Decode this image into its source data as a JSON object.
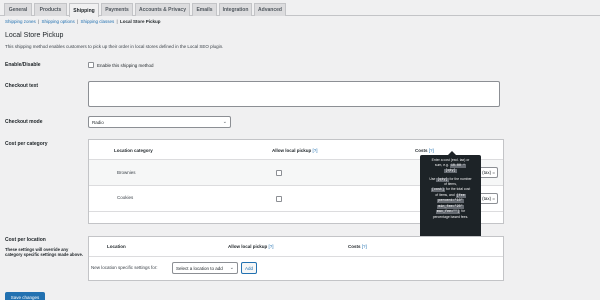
{
  "tabs": [
    {
      "label": "General",
      "active": false
    },
    {
      "label": "Products",
      "active": false
    },
    {
      "label": "Shipping",
      "active": true
    },
    {
      "label": "Payments",
      "active": false
    },
    {
      "label": "Accounts & Privacy",
      "active": false
    },
    {
      "label": "Emails",
      "active": false
    },
    {
      "label": "Integration",
      "active": false
    },
    {
      "label": "Advanced",
      "active": false
    }
  ],
  "subnav": {
    "items": [
      "Shipping zones",
      "Shipping options",
      "Shipping classes"
    ],
    "separator": "|",
    "current": "Local Store Pickup"
  },
  "page": {
    "title": "Local Store Pickup",
    "description": "This shipping method enables customers to pick up their order in local stores defined in the Local SEO plugin."
  },
  "enable": {
    "label": "Enable/Disable",
    "checkbox_label": "Enable this shipping method",
    "checked": false
  },
  "checkout_text": {
    "label": "Checkout text",
    "value": ""
  },
  "checkout_mode": {
    "label": "Checkout mode",
    "selected": "Radio"
  },
  "cost_per_category": {
    "label": "Cost per category",
    "headers": {
      "category": "Location category",
      "allow": "Allow local pickup",
      "costs": "Costs",
      "help": "[?]"
    },
    "rows": [
      {
        "category": "Brownies",
        "allow": false,
        "cost": "",
        "suffix": "(tax) ="
      },
      {
        "category": "Cookies",
        "allow": false,
        "cost": "",
        "suffix": "(tax) ="
      }
    ]
  },
  "tooltip": {
    "line1": "Enter a cost (excl. tax) or",
    "line2": "sum, e.g.",
    "code1": "10.00 *",
    "code2": "[qty]",
    "line3": "Use",
    "code3": "[qty]",
    "line3b": "for the number",
    "line4": "of items,",
    "code4": "[cost]",
    "line4b": "for the total cost",
    "line5": "of items, and",
    "code5": "[fee",
    "code6": "percent=\"10\"",
    "code7": "min_fee=\"20\"",
    "code8": "max_fee=\"\"]",
    "line6": "for",
    "line7": "percentage based fees."
  },
  "cost_per_location": {
    "label": "Cost per location",
    "help": "These settings will override any category specific settings made above.",
    "headers": {
      "location": "Location",
      "allow": "Allow local pickup",
      "costs": "Costs",
      "help": "[?]"
    },
    "new_label": "New location specific settings for:",
    "select_placeholder": "Select a location to add",
    "add_button": "Add"
  },
  "save_button": "Save changes",
  "colors": {
    "accent": "#2271b1",
    "background": "#f0f0f1",
    "tooltip_bg": "#1d2327"
  }
}
